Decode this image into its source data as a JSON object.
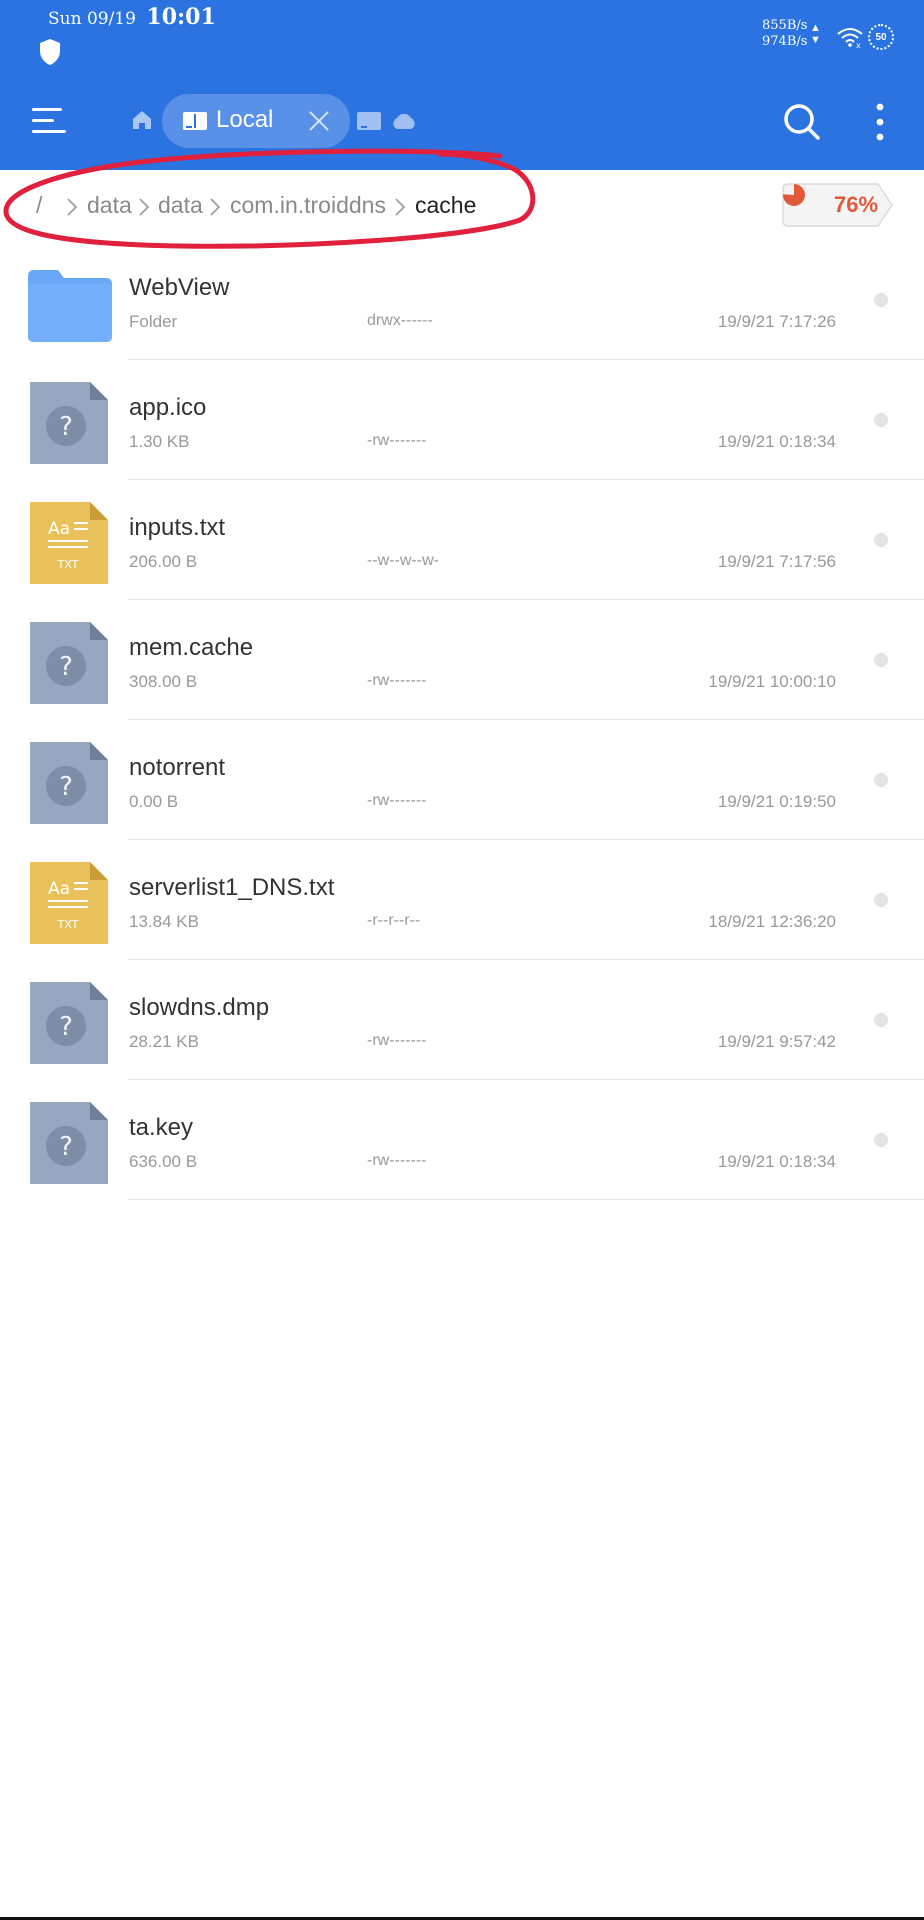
{
  "status_bar": {
    "day": "Sun 09/19",
    "time": "10:01",
    "net_up": "855B/s",
    "net_down": "974B/s",
    "signal_badge": "50"
  },
  "toolbar": {
    "tab_label": "Local"
  },
  "breadcrumb": {
    "root": "/",
    "items": [
      "data",
      "data",
      "com.in.troiddns",
      "cache"
    ]
  },
  "storage": {
    "percent_label": "76%",
    "used_fraction": 0.76,
    "color": "#e05a3a"
  },
  "colors": {
    "header": "#2a73e0",
    "folder": "#6aa8f7",
    "unknown_file": "#97a7c2",
    "txt_file": "#e9c15a",
    "annotation": "#e0203c"
  },
  "files": [
    {
      "name": "WebView",
      "size": "Folder",
      "permissions": "drwx------",
      "modified": "19/9/21 7:17:26",
      "icon": "folder-icon"
    },
    {
      "name": "app.ico",
      "size": "1.30 KB",
      "permissions": "-rw-------",
      "modified": "19/9/21 0:18:34",
      "icon": "unknown-file-icon"
    },
    {
      "name": "inputs.txt",
      "size": "206.00 B",
      "permissions": "--w--w--w-",
      "modified": "19/9/21 7:17:56",
      "icon": "text-file-icon"
    },
    {
      "name": "mem.cache",
      "size": "308.00 B",
      "permissions": "-rw-------",
      "modified": "19/9/21 10:00:10",
      "icon": "unknown-file-icon"
    },
    {
      "name": "notorrent",
      "size": "0.00 B",
      "permissions": "-rw-------",
      "modified": "19/9/21 0:19:50",
      "icon": "unknown-file-icon"
    },
    {
      "name": "serverlist1_DNS.txt",
      "size": "13.84 KB",
      "permissions": "-r--r--r--",
      "modified": "18/9/21 12:36:20",
      "icon": "text-file-icon"
    },
    {
      "name": "slowdns.dmp",
      "size": "28.21 KB",
      "permissions": "-rw-------",
      "modified": "19/9/21 9:57:42",
      "icon": "unknown-file-icon"
    },
    {
      "name": "ta.key",
      "size": "636.00 B",
      "permissions": "-rw-------",
      "modified": "19/9/21 0:18:34",
      "icon": "unknown-file-icon"
    }
  ],
  "icon_text": {
    "txt_glyph": "Aa",
    "txt_caption": "TXT",
    "unknown_glyph": "?"
  }
}
